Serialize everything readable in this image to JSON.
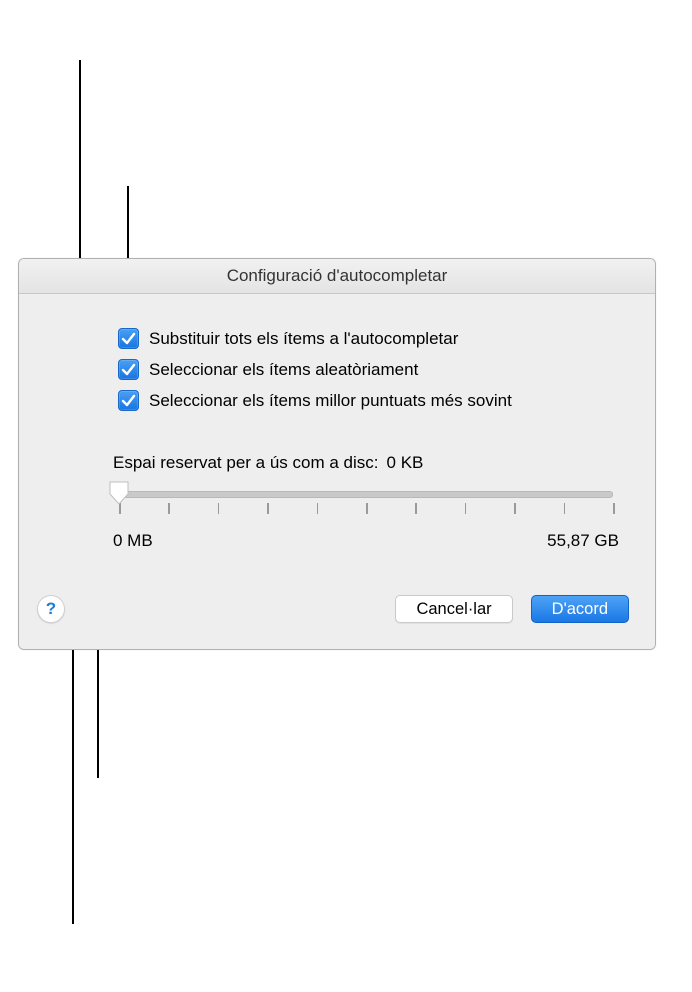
{
  "dialog": {
    "title": "Configuració d'autocompletar"
  },
  "options": {
    "replace_all": {
      "label": "Substituir tots els ítems a l'autocompletar",
      "checked": true
    },
    "random": {
      "label": "Seleccionar els ítems aleatòriament",
      "checked": true
    },
    "higher_rated": {
      "label": "Seleccionar els ítems millor puntuats més sovint",
      "checked": true
    }
  },
  "disk": {
    "label": "Espai reservat per a ús com a disc:",
    "value": "0 KB",
    "scale_min": "0 MB",
    "scale_max": "55,87 GB"
  },
  "buttons": {
    "help_glyph": "?",
    "cancel": "Cancel·lar",
    "ok": "D'acord"
  }
}
